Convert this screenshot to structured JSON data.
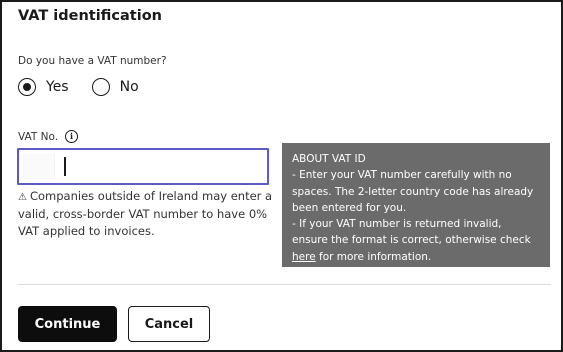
{
  "section": {
    "title": "VAT identification"
  },
  "vat_question": {
    "label": "Do you have a VAT number?",
    "options": [
      {
        "label": "Yes",
        "selected": true
      },
      {
        "label": "No",
        "selected": false
      }
    ]
  },
  "vat_field": {
    "label": "VAT No.",
    "info_icon": "info-icon",
    "value": "",
    "note": "Companies outside of Ireland may enter a valid, cross-border VAT number to have 0% VAT applied to invoices.",
    "note_icon": "warning-icon"
  },
  "about": {
    "title": "ABOUT VAT ID",
    "line1": "- Enter your VAT number carefully with no spaces. The 2-letter country code has already been entered for you.",
    "line2_prefix": "- If your VAT number is returned invalid, ensure the format is correct, otherwise check ",
    "line2_link": "here",
    "line2_suffix": " for more information."
  },
  "actions": {
    "continue_label": "Continue",
    "cancel_label": "Cancel"
  },
  "colors": {
    "input_focus_border": "#5b5bc7",
    "about_bg": "#6b6b6b",
    "primary_button_bg": "#0d0d0d"
  }
}
